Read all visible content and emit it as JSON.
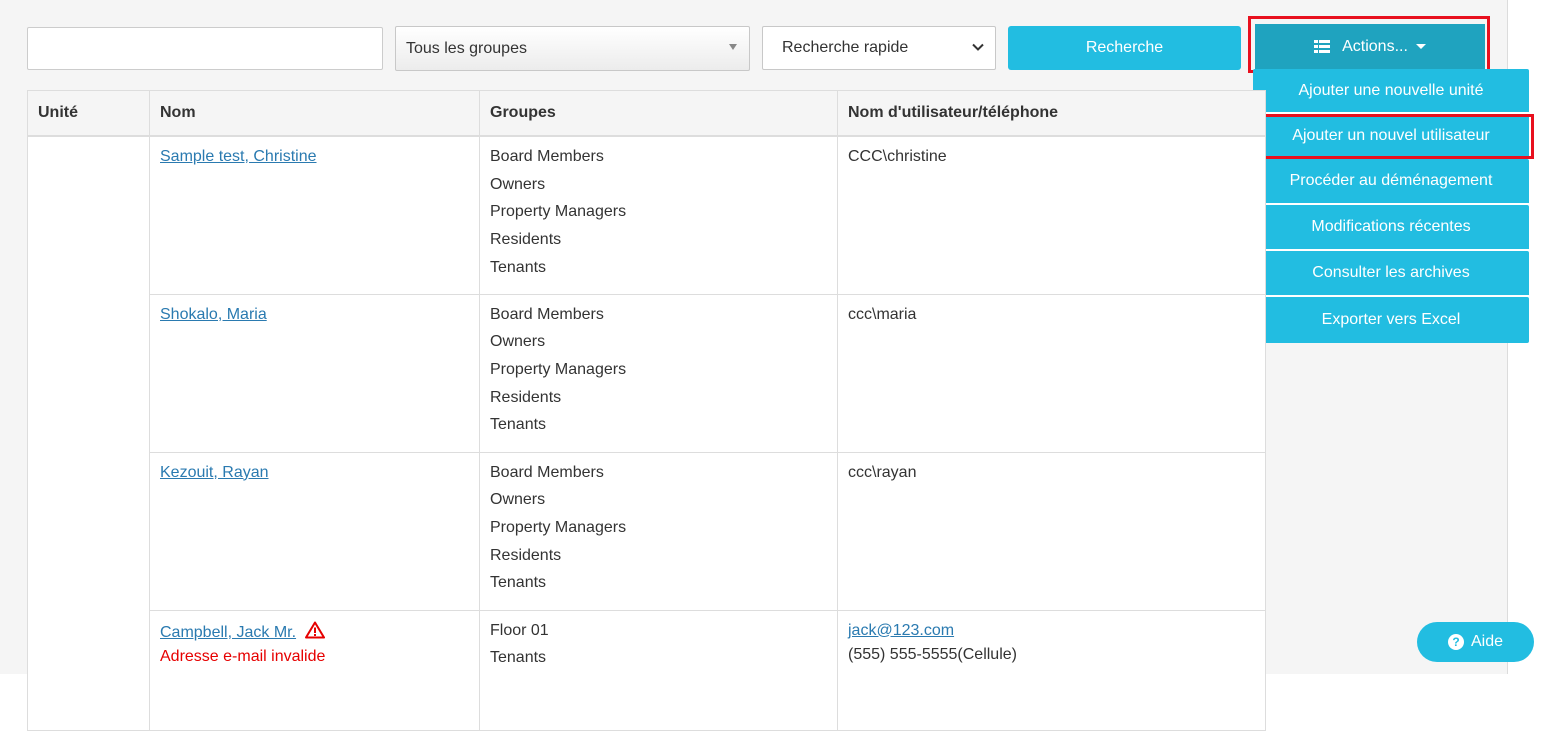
{
  "toolbar": {
    "search_value": "",
    "group_select": "Tous les groupes",
    "quick_search": "Recherche rapide",
    "search_button": "Recherche",
    "actions_button": "Actions..."
  },
  "actions_menu": [
    "Ajouter une nouvelle unité",
    "Ajouter un nouvel utilisateur",
    "Procéder au déménagement",
    "Modifications récentes",
    "Consulter les archives",
    "Exporter vers Excel"
  ],
  "table": {
    "headers": [
      "Unité",
      "Nom",
      "Groupes",
      "Nom d'utilisateur/téléphone"
    ],
    "rows": [
      {
        "unit": "",
        "name": "Sample test, Christine",
        "groups": [
          "Board Members",
          "Owners",
          "Property Managers",
          "Residents",
          "Tenants"
        ],
        "username": "CCC\\christine"
      },
      {
        "unit": "",
        "name": "Shokalo, Maria",
        "groups": [
          "Board Members",
          "Owners",
          "Property Managers",
          "Residents",
          "Tenants"
        ],
        "username": "ccc\\maria"
      },
      {
        "unit": "",
        "name": "Kezouit, Rayan",
        "groups": [
          "Board Members",
          "Owners",
          "Property Managers",
          "Residents",
          "Tenants"
        ],
        "username": "ccc\\rayan"
      },
      {
        "unit": "",
        "name": "Campbell, Jack Mr.",
        "warning": "Adresse e-mail invalide",
        "groups": [
          "Floor 01",
          "Tenants"
        ],
        "email": "jack@123.com",
        "phone": "(555) 555-5555(Cellule)"
      }
    ]
  },
  "help_button": "Aide",
  "colors": {
    "primary": "#22bde1",
    "primary_dark": "#1fa3bf",
    "highlight": "#e8101e",
    "link": "#2a7ab0",
    "error": "#e60000"
  }
}
